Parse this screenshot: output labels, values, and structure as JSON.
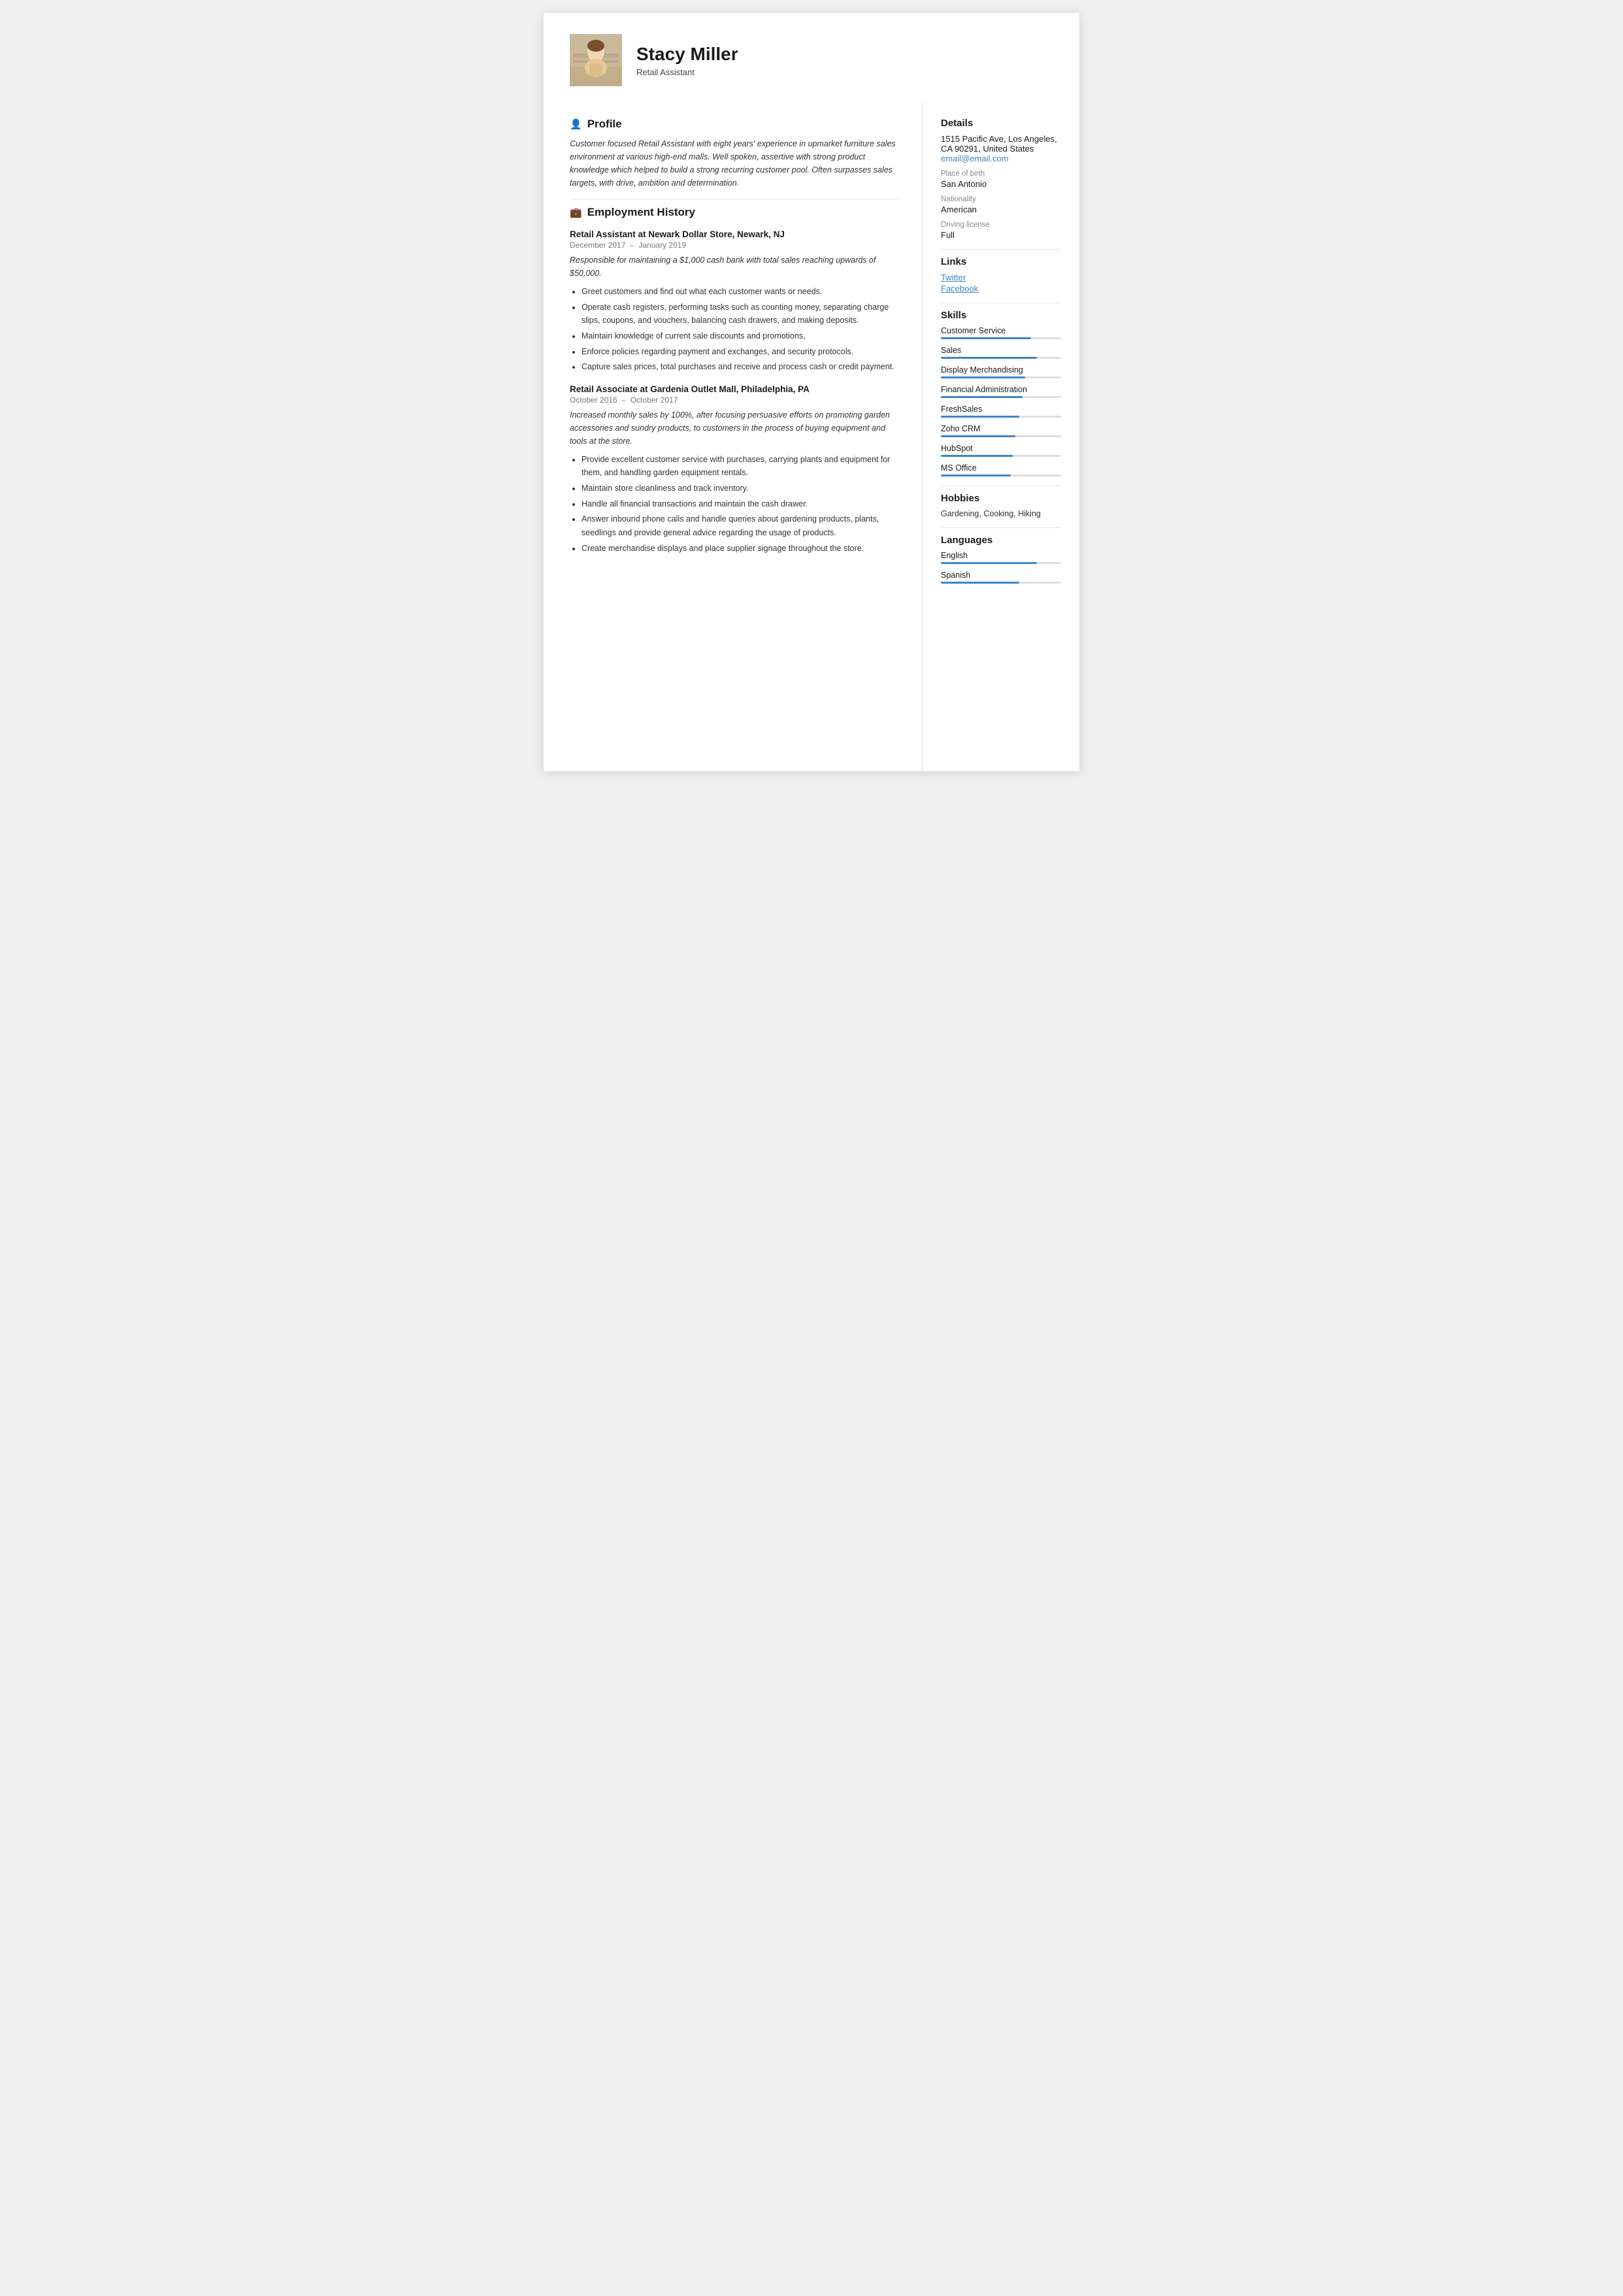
{
  "header": {
    "name": "Stacy Miller",
    "subtitle": "Retail Assistant"
  },
  "profile": {
    "section_title": "Profile",
    "text": "Customer focused Retail Assistant with eight years' experience in upmarket furniture sales environment at various high-end malls. Well spoken, assertive with strong product knowledge which helped to build a strong recurring customer pool. Often surpasses sales targets, with drive, ambition and determination."
  },
  "employment": {
    "section_title": "Employment History",
    "jobs": [
      {
        "title": "Retail Assistant at Newark Dollar Store, Newark, NJ",
        "dates": "December 2017  –  January 2019",
        "summary": "Responsible for maintaining a $1,000 cash bank with total sales reaching upwards of $50,000.",
        "bullets": [
          "Greet customers and find out what each customer wants or needs.",
          "Operate cash registers, performing tasks such as counting money, separating charge slips, coupons, and vouchers, balancing cash drawers, and making deposits.",
          "Maintain knowledge of current sale discounts and promotions,",
          "Enforce policies regarding payment and exchanges, and security protocols.",
          "Capture sales prices, total purchases and receive and process cash or credit payment."
        ]
      },
      {
        "title": "Retail Associate at Gardenia Outlet Mall, Philadelphia, PA",
        "dates": "October 2016  –  October 2017",
        "summary": "Increased monthly sales by 100%, after focusing persuasive efforts on promoting garden accessories and sundry products, to customers in the process of buying equipment and tools at the store.",
        "bullets": [
          "Provide excellent customer service with purchases, carrying plants and equipment for them, and handling garden equipment rentals.",
          "Maintain store cleanliness and track inventory.",
          "Handle all financial transactions and maintain the cash drawer.",
          "Answer inbound phone calls and handle queries about gardening products, plants, seedlings and provide general advice regarding the usage of products.",
          "Create merchandise displays and place supplier signage throughout the store."
        ]
      }
    ]
  },
  "details": {
    "section_title": "Details",
    "address": "1515 Pacific Ave, Los Angeles, CA 90291, United States",
    "email": "email@email.com",
    "place_of_birth_label": "Place of birth",
    "place_of_birth": "San Antonio",
    "nationality_label": "Nationality",
    "nationality": "American",
    "driving_license_label": "Driving license",
    "driving_license": "Full"
  },
  "links": {
    "section_title": "Links",
    "items": [
      {
        "label": "Twitter",
        "url": "#"
      },
      {
        "label": "Facebook",
        "url": "#"
      }
    ]
  },
  "skills": {
    "section_title": "Skills",
    "items": [
      {
        "name": "Customer Service",
        "pct": 75
      },
      {
        "name": "Sales",
        "pct": 80
      },
      {
        "name": "Display Merchandising",
        "pct": 70
      },
      {
        "name": "Financial Administration",
        "pct": 68
      },
      {
        "name": "FreshSales",
        "pct": 65
      },
      {
        "name": "Zoho CRM",
        "pct": 62
      },
      {
        "name": "HubSpot",
        "pct": 60
      },
      {
        "name": "MS Office",
        "pct": 58
      }
    ]
  },
  "hobbies": {
    "section_title": "Hobbies",
    "text": "Gardening, Cooking, Hiking"
  },
  "languages": {
    "section_title": "Languages",
    "items": [
      {
        "name": "English",
        "pct": 80
      },
      {
        "name": "Spanish",
        "pct": 65
      }
    ]
  }
}
